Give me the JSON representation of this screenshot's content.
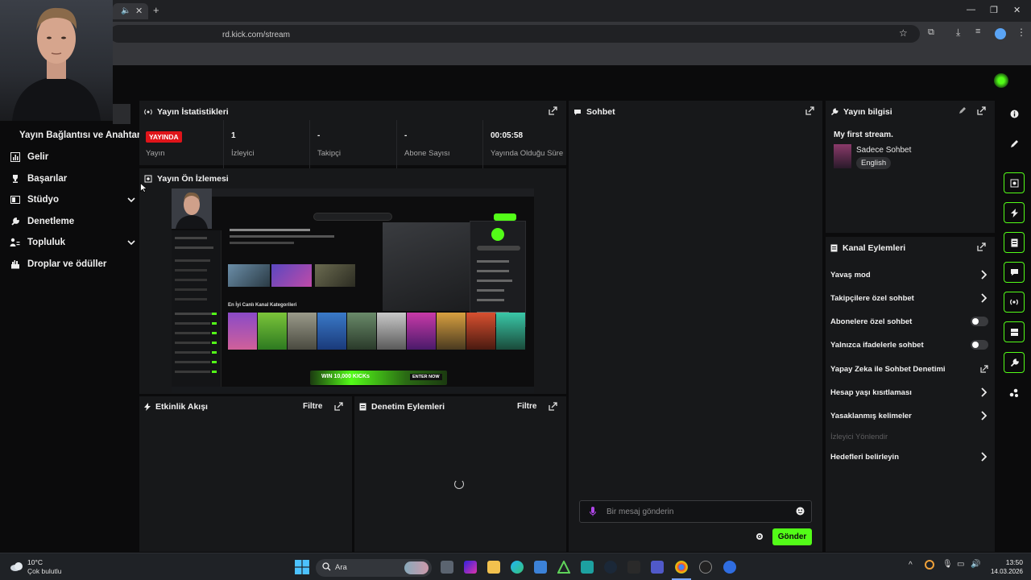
{
  "browser": {
    "url": "rd.kick.com/stream",
    "window_controls": [
      "minimize-icon",
      "maximize-icon",
      "close-icon"
    ]
  },
  "sidebar": {
    "header": "Yayın Bağlantısı ve Anahtarı",
    "items": [
      {
        "label": "Gelir",
        "icon": "chart-icon",
        "expandable": false
      },
      {
        "label": "Başarılar",
        "icon": "trophy-icon",
        "expandable": false
      },
      {
        "label": "Stüdyo",
        "icon": "studio-icon",
        "expandable": true
      },
      {
        "label": "Denetleme",
        "icon": "wrench-icon",
        "expandable": false
      },
      {
        "label": "Topluluk",
        "icon": "community-icon",
        "expandable": true
      },
      {
        "label": "Droplar ve ödüller",
        "icon": "gift-icon",
        "expandable": false
      }
    ]
  },
  "stats": {
    "title": "Yayın İstatistikleri",
    "live_badge": "YAYINDA",
    "items": [
      {
        "value": "",
        "label": "Yayın"
      },
      {
        "value": "1",
        "label": "İzleyici"
      },
      {
        "value": "-",
        "label": "Takipçi"
      },
      {
        "value": "-",
        "label": "Abone Sayısı"
      },
      {
        "value": "00:05:58",
        "label": "Yayında Olduğu Süre"
      }
    ]
  },
  "preview": {
    "title": "Yayın Ön İzlemesi",
    "section_title": "En İyi Canlı Kanal Kategorileri",
    "banner": "WIN 10,000 KICKs",
    "banner_button": "ENTER NOW"
  },
  "activity": {
    "title": "Etkinlik Akışı",
    "filter": "Filtre"
  },
  "moderation": {
    "title": "Denetim Eylemleri",
    "filter": "Filtre"
  },
  "chat": {
    "title": "Sohbet",
    "input_placeholder": "Bir mesaj gönderin",
    "send_button": "Gönder"
  },
  "stream_info": {
    "title": "Yayın bilgisi",
    "stream_title": "My first stream.",
    "category": "Sadece Sohbet",
    "language": "English"
  },
  "channel_actions": {
    "title": "Kanal Eylemleri",
    "items": [
      {
        "label": "Yavaş mod",
        "control": "chevron"
      },
      {
        "label": "Takipçilere özel sohbet",
        "control": "chevron"
      },
      {
        "label": "Abonelere özel sohbet",
        "control": "toggle",
        "on": false
      },
      {
        "label": "Yalnızca ifadelerle sohbet",
        "control": "toggle",
        "on": false
      },
      {
        "label": "Yapay Zeka ile Sohbet Denetimi",
        "control": "external"
      },
      {
        "label": "Hesap yaşı kısıtlaması",
        "control": "chevron"
      },
      {
        "label": "Yasaklanmış kelimeler",
        "control": "chevron"
      },
      {
        "label": "İzleyici Yönlendir",
        "control": "disabled"
      },
      {
        "label": "Hedefleri belirleyin",
        "control": "chevron"
      }
    ]
  },
  "taskbar": {
    "weather_temp": "10°C",
    "weather_desc": "Çok bulutlu",
    "search_placeholder": "Ara",
    "time": "13:50",
    "date": "14.03.2026"
  },
  "colors": {
    "accent": "#53fc18",
    "live": "#e0141a",
    "panel": "#17181a",
    "background": "#0b0b0c"
  }
}
